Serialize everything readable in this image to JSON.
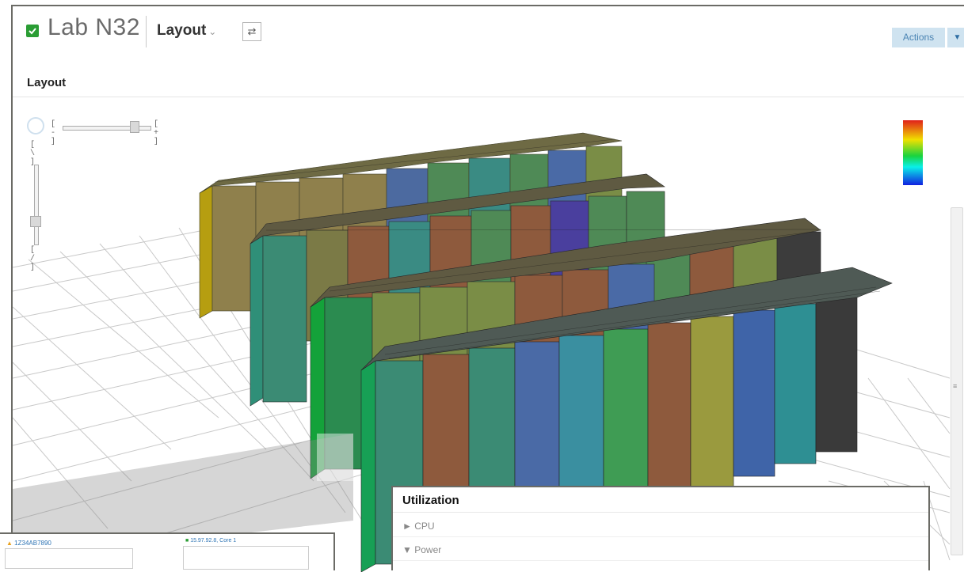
{
  "header": {
    "title": "Lab N32",
    "layout_label": "Layout",
    "actions_label": "Actions"
  },
  "section": {
    "title": "Layout"
  },
  "zoom": {
    "minus": "[ - ]",
    "plus": "[ + ]",
    "top_label": "[ \\ ]",
    "bottom_label": "[ / ]"
  },
  "utilization": {
    "title": "Utilization",
    "items": [
      {
        "arrow": "►",
        "label": "CPU"
      },
      {
        "arrow": "▼",
        "label": "Power"
      }
    ]
  },
  "association": {
    "node_a": "1Z34AB7890",
    "node_b": "15.97.92.8, Core 1"
  },
  "icons": {
    "status": "check-square-icon",
    "graph": "graph-view-icon",
    "dropdown": "chevron-down-icon"
  },
  "colors": {
    "accent": "#2a9d34",
    "actions_bg": "#cfe3f0",
    "actions_text": "#4b84b3"
  }
}
